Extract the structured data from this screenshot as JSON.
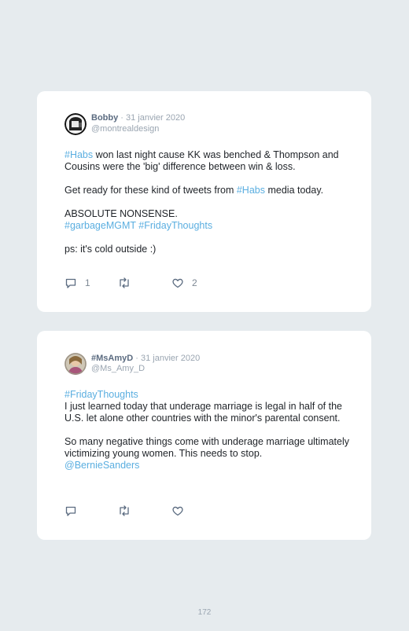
{
  "tweets": [
    {
      "name": "Bobby",
      "date": "· 31 janvier 2020",
      "handle": "@montrealdesign",
      "avatar_icon": "profile-photo-dark",
      "p1_tag": "#Habs",
      "p1_text": " won last night cause KK was benched & Thompson and Cousins were the 'big' difference between win & loss.",
      "p2_text": "Get ready for these kind of tweets from ",
      "p2_tag": "#Habs",
      "p2_end": " media today.",
      "p3_text": "ABSOLUTE NONSENSE.",
      "p3_tag1": "#garbageMGMT",
      "p3_tag2": "#FridayThoughts",
      "p4_text": "ps: it's cold outside :)",
      "reply_count": "1",
      "like_count": "2"
    },
    {
      "name": "#MsAmyD",
      "date": "· 31 janvier 2020",
      "handle": "@Ms_Amy_D",
      "avatar_icon": "profile-photo-light",
      "p1_tag": "#FridayThoughts",
      "p1_text": "I just learned today that underage marriage is legal in half of the U.S. let alone other countries with the minor's parental consent.",
      "p2_text": "So many negative things come with underage marriage ultimately victimizing young women. This needs to stop.",
      "p2_tag": "@BernieSanders"
    }
  ],
  "colors": {
    "hashtag": "#5aaee0",
    "name": "#5b6b80",
    "muted": "#9aa5b1",
    "background": "#e6ebee"
  },
  "icons": [
    "reply-icon",
    "retweet-icon",
    "like-icon"
  ],
  "page_number": "172"
}
